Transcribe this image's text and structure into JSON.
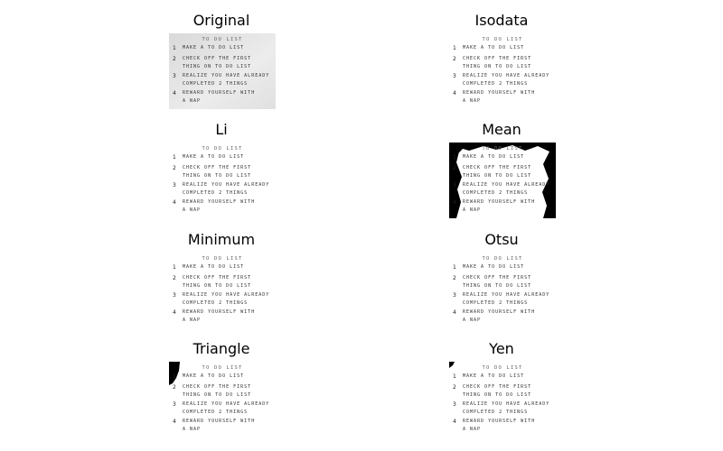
{
  "panels": [
    {
      "title": "Original",
      "variant": "original"
    },
    {
      "title": "Isodata",
      "variant": "clean"
    },
    {
      "title": "Li",
      "variant": "clean"
    },
    {
      "title": "Mean",
      "variant": "mean"
    },
    {
      "title": "Minimum",
      "variant": "clean"
    },
    {
      "title": "Otsu",
      "variant": "clean"
    },
    {
      "title": "Triangle",
      "variant": "corner-large"
    },
    {
      "title": "Yen",
      "variant": "corner-small"
    }
  ],
  "note": {
    "heading": "TO DO LIST",
    "items": [
      {
        "num": "1",
        "lines": [
          "MAKE A TO DO LIST"
        ]
      },
      {
        "num": "2",
        "lines": [
          "CHECK OFF THE FIRST",
          "THING ON TO DO LIST"
        ]
      },
      {
        "num": "3",
        "lines": [
          "REALIZE YOU HAVE ALREADY",
          "COMPLETED 2 THINGS"
        ]
      },
      {
        "num": "4",
        "lines": [
          "REWARD YOURSELF WITH",
          "A NAP"
        ]
      }
    ]
  },
  "colors": {
    "paper": "#e4e4e4",
    "ink": "#222222",
    "mask": "#000000"
  }
}
